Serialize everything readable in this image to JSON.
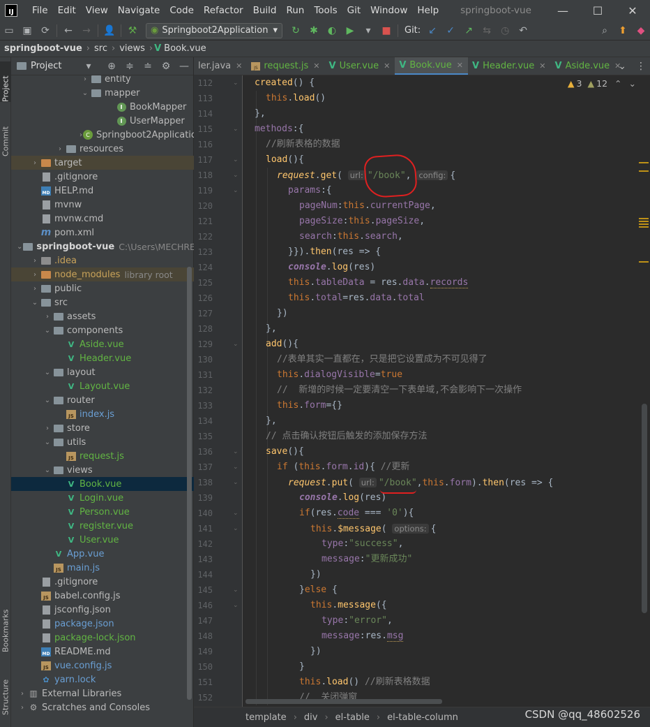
{
  "window": {
    "logo": "IJ",
    "title": "springboot-vue",
    "menu": [
      "File",
      "Edit",
      "View",
      "Navigate",
      "Code",
      "Refactor",
      "Build",
      "Run",
      "Tools",
      "Git",
      "Window",
      "Help"
    ],
    "minimize": "—",
    "maximize": "☐",
    "close": "✕"
  },
  "toolbar": {
    "run_config": "Springboot2Application",
    "git_label": "Git:"
  },
  "navbar": {
    "crumbs": [
      "springboot-vue",
      "src",
      "views",
      "Book.vue"
    ]
  },
  "left_strip": {
    "project": "Project",
    "commit": "Commit",
    "bookmarks": "Bookmarks",
    "structure": "Structure"
  },
  "project_panel": {
    "title": "Project",
    "tree": [
      {
        "label": "entity",
        "kind": "folder",
        "depth": 6,
        "arrow": "›"
      },
      {
        "label": "mapper",
        "kind": "folder",
        "depth": 6,
        "arrow": "⌄"
      },
      {
        "label": "BookMapper",
        "kind": "interface",
        "depth": 8,
        "arrow": ""
      },
      {
        "label": "UserMapper",
        "kind": "interface",
        "depth": 8,
        "arrow": ""
      },
      {
        "label": "Springboot2Applicatio",
        "kind": "spring",
        "depth": 6,
        "arrow": "›"
      },
      {
        "label": "resources",
        "kind": "folder",
        "depth": 4,
        "arrow": "›"
      },
      {
        "label": "target",
        "kind": "folder-orange",
        "depth": 2,
        "arrow": "›",
        "row": "excluded"
      },
      {
        "label": ".gitignore",
        "kind": "file",
        "depth": 2,
        "arrow": ""
      },
      {
        "label": "HELP.md",
        "kind": "md",
        "depth": 2,
        "arrow": ""
      },
      {
        "label": "mvnw",
        "kind": "file",
        "depth": 2,
        "arrow": ""
      },
      {
        "label": "mvnw.cmd",
        "kind": "file",
        "depth": 2,
        "arrow": ""
      },
      {
        "label": "pom.xml",
        "kind": "m",
        "depth": 2,
        "arrow": ""
      },
      {
        "label": "springboot-vue",
        "kind": "folder",
        "depth": 1,
        "arrow": "⌄",
        "style": "bold",
        "hint": "C:\\Users\\MECHREVO"
      },
      {
        "label": ".idea",
        "kind": "folder-gray",
        "depth": 2,
        "arrow": "›",
        "style": "ignored"
      },
      {
        "label": "node_modules",
        "kind": "folder-orange",
        "depth": 2,
        "arrow": "›",
        "style": "ignored",
        "hint": "library root",
        "row": "excluded"
      },
      {
        "label": "public",
        "kind": "folder",
        "depth": 2,
        "arrow": "›"
      },
      {
        "label": "src",
        "kind": "folder",
        "depth": 2,
        "arrow": "⌄"
      },
      {
        "label": "assets",
        "kind": "folder",
        "depth": 3,
        "arrow": "›"
      },
      {
        "label": "components",
        "kind": "folder",
        "depth": 3,
        "arrow": "⌄"
      },
      {
        "label": "Aside.vue",
        "kind": "vue",
        "depth": 4,
        "arrow": "",
        "style": "vuefile"
      },
      {
        "label": "Header.vue",
        "kind": "vue",
        "depth": 4,
        "arrow": "",
        "style": "vuefile"
      },
      {
        "label": "layout",
        "kind": "folder",
        "depth": 3,
        "arrow": "⌄"
      },
      {
        "label": "Layout.vue",
        "kind": "vue",
        "depth": 4,
        "arrow": "",
        "style": "vuefile"
      },
      {
        "label": "router",
        "kind": "folder",
        "depth": 3,
        "arrow": "⌄"
      },
      {
        "label": "index.js",
        "kind": "js",
        "depth": 4,
        "arrow": "",
        "style": "jsblue"
      },
      {
        "label": "store",
        "kind": "folder",
        "depth": 3,
        "arrow": "›"
      },
      {
        "label": "utils",
        "kind": "folder",
        "depth": 3,
        "arrow": "⌄"
      },
      {
        "label": "request.js",
        "kind": "js",
        "depth": 4,
        "arrow": "",
        "style": "vuefile"
      },
      {
        "label": "views",
        "kind": "folder",
        "depth": 3,
        "arrow": "⌄"
      },
      {
        "label": "Book.vue",
        "kind": "vue",
        "depth": 4,
        "arrow": "",
        "style": "vuefile",
        "row": "selected"
      },
      {
        "label": "Login.vue",
        "kind": "vue",
        "depth": 4,
        "arrow": "",
        "style": "vuefile"
      },
      {
        "label": "Person.vue",
        "kind": "vue",
        "depth": 4,
        "arrow": "",
        "style": "vuefile"
      },
      {
        "label": "register.vue",
        "kind": "vue",
        "depth": 4,
        "arrow": "",
        "style": "vuefile"
      },
      {
        "label": "User.vue",
        "kind": "vue",
        "depth": 4,
        "arrow": "",
        "style": "vuefile"
      },
      {
        "label": "App.vue",
        "kind": "vue",
        "depth": 3,
        "arrow": "",
        "style": "jsblue"
      },
      {
        "label": "main.js",
        "kind": "js",
        "depth": 3,
        "arrow": "",
        "style": "jsblue"
      },
      {
        "label": ".gitignore",
        "kind": "file",
        "depth": 2,
        "arrow": ""
      },
      {
        "label": "babel.config.js",
        "kind": "js",
        "depth": 2,
        "arrow": ""
      },
      {
        "label": "jsconfig.json",
        "kind": "file",
        "depth": 2,
        "arrow": ""
      },
      {
        "label": "package.json",
        "kind": "file",
        "depth": 2,
        "arrow": "",
        "style": "jsblue"
      },
      {
        "label": "package-lock.json",
        "kind": "file",
        "depth": 2,
        "arrow": "",
        "style": "vuefile"
      },
      {
        "label": "README.md",
        "kind": "md",
        "depth": 2,
        "arrow": ""
      },
      {
        "label": "vue.config.js",
        "kind": "js",
        "depth": 2,
        "arrow": "",
        "style": "jsblue"
      },
      {
        "label": "yarn.lock",
        "kind": "yarn",
        "depth": 2,
        "arrow": "",
        "style": "jsblue"
      },
      {
        "label": "External Libraries",
        "kind": "lib",
        "depth": 1,
        "arrow": "›"
      },
      {
        "label": "Scratches and Consoles",
        "kind": "scratch",
        "depth": 1,
        "arrow": "›"
      }
    ]
  },
  "editor_tabs": [
    {
      "label": "ler.java",
      "type": "java"
    },
    {
      "label": "request.js",
      "type": "js"
    },
    {
      "label": "User.vue",
      "type": "vue"
    },
    {
      "label": "Book.vue",
      "type": "vue",
      "active": true
    },
    {
      "label": "Header.vue",
      "type": "vue"
    },
    {
      "label": "Aside.vue",
      "type": "vue"
    }
  ],
  "inspections": {
    "warnings": "3",
    "weak_warnings": "12"
  },
  "code": {
    "line_numbers": [
      "112",
      "113",
      "114",
      "115",
      "116",
      "117",
      "118",
      "119",
      "120",
      "121",
      "122",
      "123",
      "124",
      "125",
      "126",
      "127",
      "128",
      "129",
      "130",
      "131",
      "132",
      "133",
      "134",
      "135",
      "136",
      "137",
      "138",
      "139",
      "140",
      "141",
      "142",
      "143",
      "144",
      "145",
      "146",
      "147",
      "148",
      "149",
      "150",
      "151",
      "152"
    ],
    "comments": {
      "refresh_table": "//刷新表格的数据",
      "form_note": "//表单其实一直都在，只是把它设置成为不可见得了",
      "clear_note": "//  新增的时候一定要清空一下表单域,不会影响下一次操作",
      "save_note": "// 点击确认按钮后触发的添加保存方法",
      "update_note": "//更新",
      "refresh_again": "//刷新表格数据",
      "close_dialog": "//  关闭弹窗"
    },
    "strings": {
      "book_path": "\"/book\"",
      "zero": "'0'",
      "success": "\"success\"",
      "update_success": "\"更新成功\"",
      "error": "\"error\""
    },
    "hints": {
      "url": "url:",
      "config": "config:",
      "options": "options:"
    }
  },
  "code_breadcrumb": [
    "template",
    "div",
    "el-table",
    "el-table-column"
  ],
  "watermark": "CSDN @qq_48602526"
}
